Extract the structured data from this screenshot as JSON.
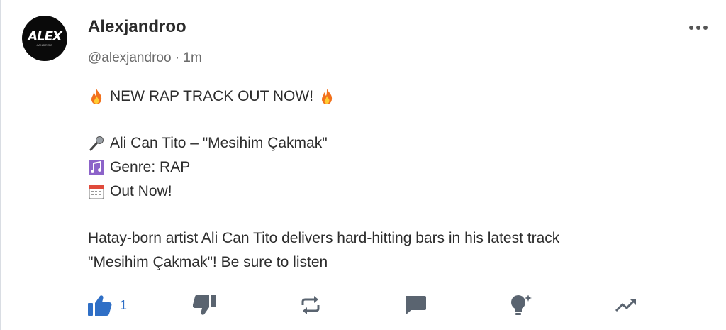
{
  "post": {
    "display_name": "Alexjandroo",
    "handle": "@alexjandroo",
    "separator": "·",
    "time": "1m",
    "avatar_logo": "ALEX",
    "avatar_sub": "JANDROO",
    "lines": {
      "headline": "NEW RAP TRACK OUT NOW!",
      "track": "Ali Can Tito – \"Mesihim Çakmak\"",
      "genre": "Genre: RAP",
      "out": "Out Now!",
      "desc1": "Hatay-born artist Ali Can Tito delivers hard-hitting bars in his latest track",
      "desc2": "\"Mesihim Çakmak\"! Be sure to listen"
    },
    "icons": {
      "headline_left": "fire-emoji",
      "headline_right": "fire-emoji",
      "track": "microphone-emoji",
      "genre": "music-notes-emoji",
      "out": "calendar-emoji"
    }
  },
  "actions": {
    "like_count": "1",
    "items": [
      "like",
      "dislike",
      "repost",
      "comment",
      "insight",
      "trending"
    ],
    "accent": "#2f6fc6",
    "icon_color": "#5a6470"
  }
}
